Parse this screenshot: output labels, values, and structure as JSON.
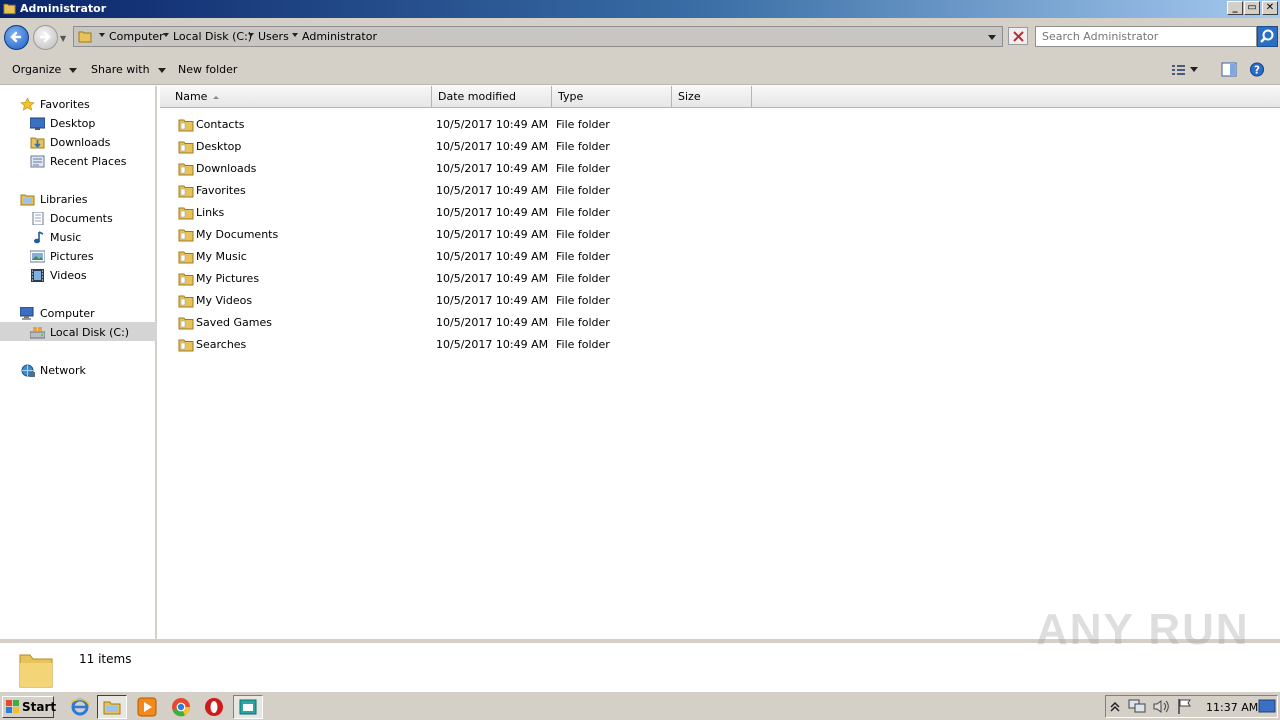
{
  "window": {
    "title": "Administrator",
    "buttons": {
      "minimize": "_",
      "restore": "▭",
      "close": "✕"
    }
  },
  "address": {
    "crumbs": [
      "Computer",
      "Local Disk (C:)",
      "Users",
      "Administrator"
    ],
    "search_placeholder": "Search Administrator"
  },
  "toolbar": {
    "organize": "Organize",
    "share_with": "Share with",
    "new_folder": "New folder"
  },
  "nav": {
    "favorites": {
      "label": "Favorites",
      "items": [
        "Desktop",
        "Downloads",
        "Recent Places"
      ]
    },
    "libraries": {
      "label": "Libraries",
      "items": [
        "Documents",
        "Music",
        "Pictures",
        "Videos"
      ]
    },
    "computer": {
      "label": "Computer",
      "items": [
        "Local Disk (C:)"
      ]
    },
    "network": {
      "label": "Network"
    }
  },
  "columns": [
    "Name",
    "Date modified",
    "Type",
    "Size"
  ],
  "files": [
    {
      "name": "Contacts",
      "date": "10/5/2017 10:49 AM",
      "type": "File folder"
    },
    {
      "name": "Desktop",
      "date": "10/5/2017 10:49 AM",
      "type": "File folder"
    },
    {
      "name": "Downloads",
      "date": "10/5/2017 10:49 AM",
      "type": "File folder"
    },
    {
      "name": "Favorites",
      "date": "10/5/2017 10:49 AM",
      "type": "File folder"
    },
    {
      "name": "Links",
      "date": "10/5/2017 10:49 AM",
      "type": "File folder"
    },
    {
      "name": "My Documents",
      "date": "10/5/2017 10:49 AM",
      "type": "File folder"
    },
    {
      "name": "My Music",
      "date": "10/5/2017 10:49 AM",
      "type": "File folder"
    },
    {
      "name": "My Pictures",
      "date": "10/5/2017 10:49 AM",
      "type": "File folder"
    },
    {
      "name": "My Videos",
      "date": "10/5/2017 10:49 AM",
      "type": "File folder"
    },
    {
      "name": "Saved Games",
      "date": "10/5/2017 10:49 AM",
      "type": "File folder"
    },
    {
      "name": "Searches",
      "date": "10/5/2017 10:49 AM",
      "type": "File folder"
    }
  ],
  "details": {
    "item_count": "11 items"
  },
  "watermark": "ANY RUN",
  "taskbar": {
    "start_label": "Start",
    "clock": "11:37 AM"
  },
  "colors": {
    "folder": "#e8c35a",
    "title_start": "#0a246a",
    "title_end": "#a6caf0",
    "selection": "#d4d4d4"
  }
}
